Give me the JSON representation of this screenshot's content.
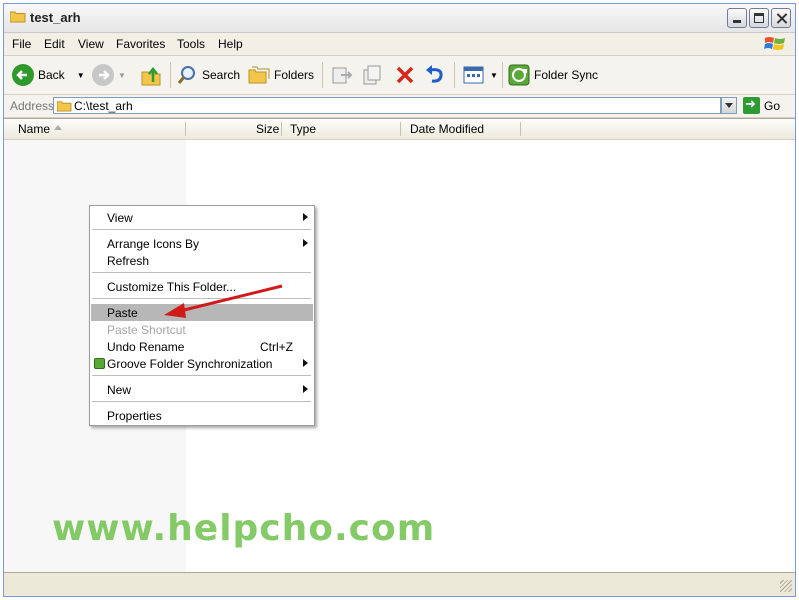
{
  "window": {
    "title": "test_arh"
  },
  "menubar": {
    "items": [
      "File",
      "Edit",
      "View",
      "Favorites",
      "Tools",
      "Help"
    ]
  },
  "toolbar": {
    "back_label": "Back",
    "search_label": "Search",
    "folders_label": "Folders",
    "folder_sync_label": "Folder Sync"
  },
  "address": {
    "label": "Address",
    "value": "C:\\test_arh",
    "go_label": "Go"
  },
  "list": {
    "columns": [
      "Name",
      "Size",
      "Type",
      "Date Modified"
    ]
  },
  "context_menu": {
    "view": "View",
    "arrange_icons_by": "Arrange Icons By",
    "refresh": "Refresh",
    "customize": "Customize This Folder...",
    "paste": "Paste",
    "paste_shortcut": "Paste Shortcut",
    "undo_rename": "Undo Rename",
    "undo_rename_shortcut": "Ctrl+Z",
    "groove_sync": "Groove Folder Synchronization",
    "new": "New",
    "properties": "Properties"
  },
  "watermark": {
    "text": "www.helpcho.com"
  },
  "colors": {
    "highlight": "#b7b7b7",
    "annotation_arrow": "#d11a1a",
    "watermark": "#6fc24d"
  }
}
